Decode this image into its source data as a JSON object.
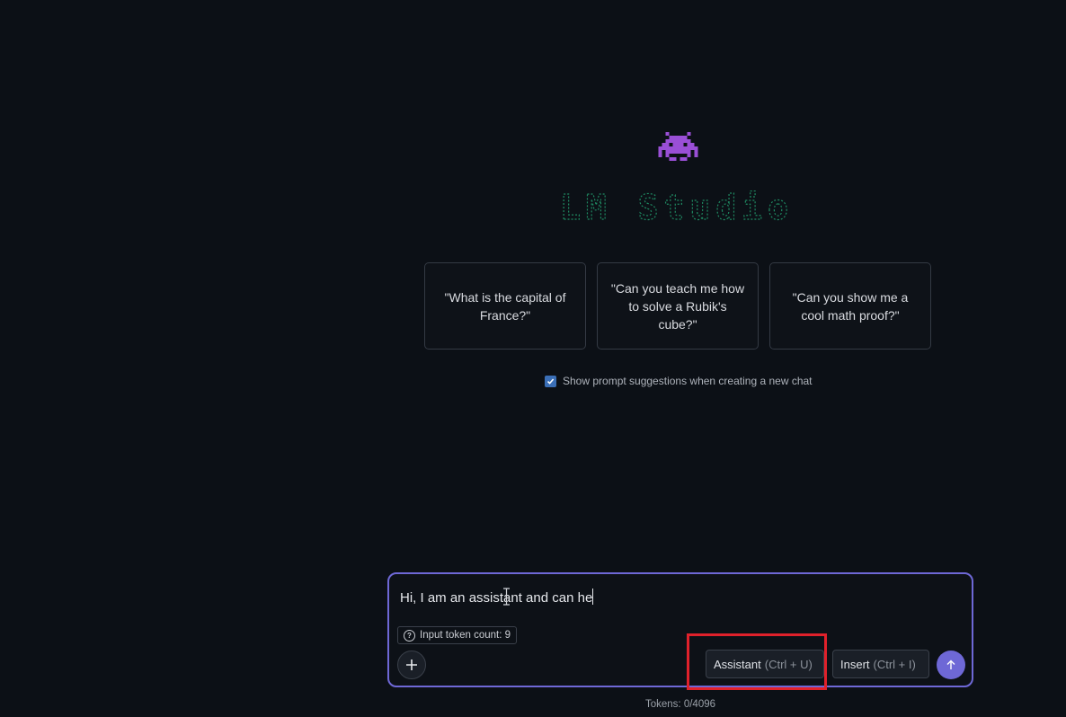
{
  "header": {
    "mascot_icon": "space-invader-icon",
    "banner_text": "LM Studio"
  },
  "suggestions": [
    {
      "label": "\"What is the capital of France?\""
    },
    {
      "label": "\"Can you teach me how to solve a Rubik's cube?\""
    },
    {
      "label": "\"Can you show me a cool math proof?\""
    }
  ],
  "suggestion_toggle": {
    "label": "Show prompt suggestions when creating a new chat",
    "checked": true
  },
  "composer": {
    "input_value": "Hi, I am an assistant and can he",
    "token_count_label": "Input token count: 9",
    "add_icon": "plus-icon",
    "assistant_button": {
      "label": "Assistant",
      "hint": "(Ctrl + U)"
    },
    "insert_button": {
      "label": "Insert",
      "hint": "(Ctrl + I)"
    },
    "send_icon": "arrow-up-icon"
  },
  "footer": {
    "tokens_label": "Tokens: 0/4096"
  },
  "colors": {
    "background": "#0c1016",
    "accent": "#6e68d6",
    "mascot": "#9a4fd6",
    "banner": "#1f8a62",
    "highlight": "#e0212b"
  }
}
